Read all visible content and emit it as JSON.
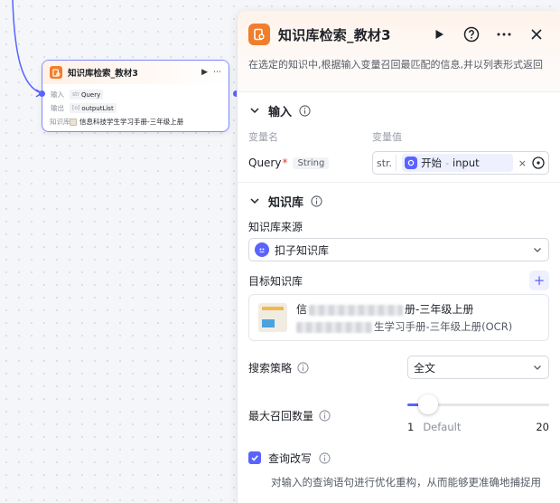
{
  "node": {
    "title": "知识库检索_教材3",
    "rows": [
      {
        "key": "输入",
        "type": "str",
        "value": "Query"
      },
      {
        "key": "输出",
        "type": "[o]",
        "value": "outputList"
      },
      {
        "key": "知识库",
        "value": "信息科技学生学习手册-三年级上册"
      }
    ]
  },
  "panel": {
    "title": "知识库检索_教材3",
    "description": "在选定的知识中,根据输入变量召回最匹配的信息,并以列表形式返回",
    "input_section": {
      "title": "输入",
      "col_name": "变量名",
      "col_value": "变量值",
      "var_name": "Query",
      "required_mark": "*",
      "var_type": "String",
      "value_type": "str.",
      "ref_node": "开始",
      "ref_sep": " - ",
      "ref_field": "input",
      "clear": "×"
    },
    "kb_section": {
      "title": "知识库",
      "source_label": "知识库来源",
      "source_value": "扣子知识库",
      "target_label": "目标知识库",
      "add": "+",
      "kb_title_prefix": "信",
      "kb_title_suffix": "册-三年级上册",
      "kb_sub_suffix": "生学习手册-三年级上册(OCR)",
      "strategy_label": "搜索策略",
      "strategy_value": "全文",
      "max_label": "最大召回数量",
      "max_value": 1,
      "max_min": "1",
      "max_max": "20",
      "max_default": "Default",
      "rewrite_label": "查询改写",
      "rewrite_checked": true,
      "rewrite_desc": "对输入的查询语句进行优化重构，从而能够更准确地捕捉用"
    }
  },
  "colors": {
    "accent": "#5a63ff",
    "node_icon": "#f07e2c",
    "required": "#ee3333"
  }
}
